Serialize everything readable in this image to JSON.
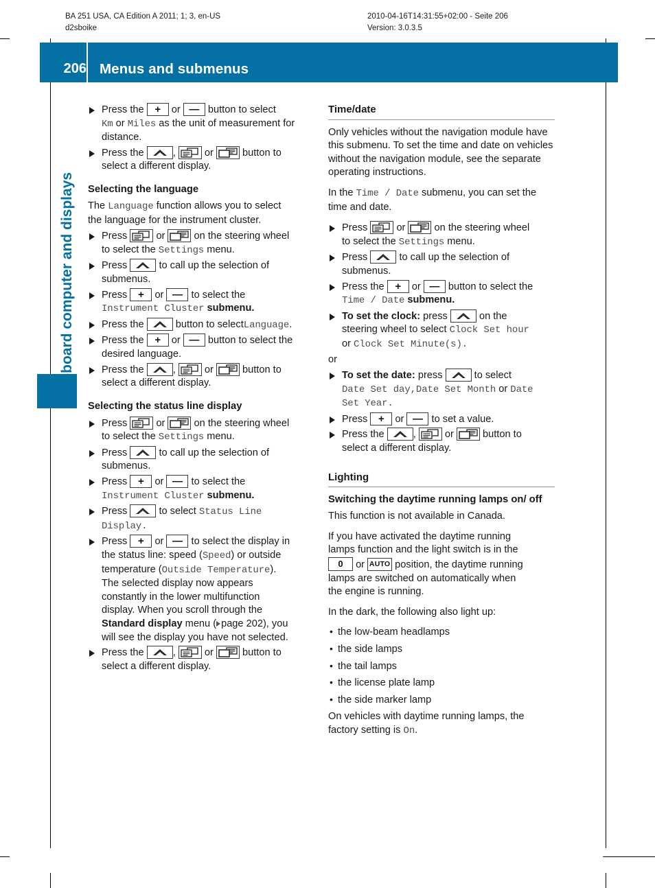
{
  "print_header": {
    "left_line1": "BA 251 USA, CA Edition A 2011; 1; 3, en-US",
    "left_line2": "d2sboike",
    "right_line1": "2010-04-16T14:31:55+02:00 - Seite 206",
    "right_line2": "Version: 3.0.3.5"
  },
  "header": {
    "page_number": "206",
    "title": "Menus and submenus",
    "band_color": "#0470a4"
  },
  "chapter_tab": {
    "label": "On-board computer and displays",
    "color": "#0470a4"
  },
  "left_column": {
    "step_unit": {
      "pre": "Press the",
      "mid": "or",
      "post": "button to select",
      "line2_a": "Km",
      "line2_or": "or",
      "line2_b": "Miles",
      "line2_rest": "as the unit of measurement for",
      "line3": "distance."
    },
    "step_display_1": {
      "pre": "Press the",
      "comma": ",",
      "mid": "or",
      "post": "button to",
      "line2": "select a different display."
    },
    "heading_language": "Selecting the language",
    "language_intro": {
      "pre": "The",
      "mono": "Language",
      "post": "function allows you to select",
      "line2": "the language for the instrument cluster."
    },
    "step_settings_1": {
      "pre": "Press",
      "mid": "or",
      "post": "on the steering wheel",
      "line2_pre": "to select the",
      "line2_mono": "Settings",
      "line2_post": "menu."
    },
    "step_submenus_1": {
      "pre": "Press",
      "post": "to call up the selection of",
      "line2": "submenus."
    },
    "step_cluster_1": {
      "pre": "Press",
      "mid": "or",
      "post": "to select the",
      "line2_mono": "Instrument Cluster",
      "line2_post": "submenu."
    },
    "step_language_select": {
      "pre": "Press the",
      "post": "button to select",
      "mono": "Language",
      "period": "."
    },
    "step_desired_language": {
      "pre": "Press the",
      "mid": "or",
      "post": "button to select the",
      "line2": "desired language."
    },
    "step_display_2": {
      "pre": "Press the",
      "comma": ",",
      "mid": "or",
      "post": "button to",
      "line2": "select a different display."
    },
    "heading_status_line": "Selecting the status line display",
    "step_settings_2": {
      "pre": "Press",
      "mid": "or",
      "post": "on the steering wheel",
      "line2_pre": "to select the",
      "line2_mono": "Settings",
      "line2_post": "menu."
    },
    "step_submenus_2": {
      "pre": "Press",
      "post": "to call up the selection of",
      "line2": "submenus."
    },
    "step_cluster_2": {
      "pre": "Press",
      "mid": "or",
      "post": "to select the",
      "line2_mono": "Instrument Cluster",
      "line2_post": "submenu."
    },
    "step_status_select": {
      "pre": "Press",
      "post": "to select",
      "mono1": "Status Line",
      "mono2": "Display",
      "period": "."
    },
    "step_status_display": {
      "pre": "Press",
      "mid": "or",
      "post": "to select the display in",
      "line2_pre": "the status line: speed (",
      "line2_mono": "Speed",
      "line2_post": ") or outside",
      "line3_pre": "temperature (",
      "line3_mono": "Outside Temperature",
      "line3_post": ").",
      "line4": "The selected display now appears",
      "line5": "constantly in the lower multifunction",
      "line6": "display. When you scroll through the",
      "line7_bold": "Standard display",
      "line7_mid": "menu (",
      "line7_ref": "page 202), you",
      "line8": "will see the display you have not selected."
    },
    "step_display_3": {
      "pre": "Press the",
      "comma": ",",
      "mid": "or",
      "post": "button to",
      "line2": "select a different display."
    }
  },
  "right_column": {
    "heading_time_date": "Time/date",
    "para_1": "Only vehicles without the navigation module have this submenu. To set the time and date on vehicles without the navigation module, see the separate operating instructions.",
    "para_2": {
      "pre": "In the",
      "mono": "Time / Date",
      "post": "submenu, you can set the",
      "line2": "time and date."
    },
    "step_settings": {
      "pre": "Press",
      "mid": "or",
      "post": "on the steering wheel",
      "line2_pre": "to select the",
      "line2_mono": "Settings",
      "line2_post": "menu."
    },
    "step_submenus": {
      "pre": "Press",
      "post": "to call up the selection of",
      "line2": "submenus."
    },
    "step_timedate": {
      "pre": "Press the",
      "mid": "or",
      "post": "button to select the",
      "line2_mono": "Time / Date",
      "line2_post": "submenu."
    },
    "step_clock": {
      "bold": "To set the clock:",
      "pre": "press",
      "post": "on the",
      "line2_pre": "steering wheel to select",
      "line2_mono": "Clock Set hour",
      "line3_pre": "or",
      "line3_mono": "Clock Set Minute(s)."
    },
    "or_text": "or",
    "step_date": {
      "bold": "To set the date:",
      "pre": "press",
      "post": "to select",
      "line2_mono_a": "Date Set day,",
      "line2_mono_b": "Date Set Month",
      "line2_or": "or",
      "line2_mono_c": "Date",
      "line3_mono": "Set Year."
    },
    "step_value": {
      "pre": "Press",
      "mid": "or",
      "post": "to set a value."
    },
    "step_display": {
      "pre": "Press the",
      "comma": ",",
      "mid": "or",
      "post": "button to",
      "line2": "select a different display."
    },
    "heading_lighting": "Lighting",
    "sub_heading_drl": "Switching the daytime running lamps on/ off",
    "para_canada": "This function is not available in Canada.",
    "para_drl": {
      "line1": "If you have activated the daytime running",
      "line2": "lamps function and the light switch is in the",
      "line3_or": "or",
      "line3_post": "position, the daytime running",
      "line4": "lamps are switched on automatically when",
      "line5": "the engine is running."
    },
    "para_dark": "In the dark, the following also light up:",
    "lamp_list": [
      "the low-beam headlamps",
      "the side lamps",
      "the tail lamps",
      "the license plate lamp",
      "the side marker lamp"
    ],
    "para_factory": {
      "line1": "On vehicles with daytime running lamps, the",
      "line2_pre": "factory setting is",
      "line2_mono": "On",
      "line2_post": "."
    }
  },
  "icons": {
    "plus": "+",
    "minus": "—",
    "up_arrow": "up-arrow-key",
    "window_list": "window-list-key",
    "window_blank": "window-blank-key",
    "light_off": "0",
    "light_auto": "AUTO"
  }
}
